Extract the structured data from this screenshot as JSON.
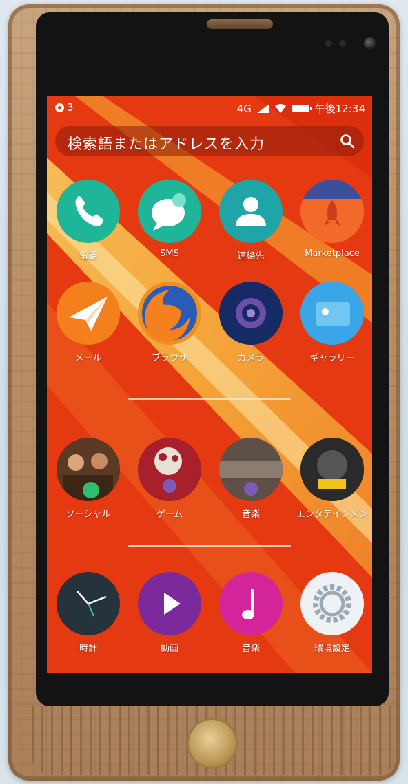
{
  "status_bar": {
    "notification_count": "3",
    "network": "4G",
    "time": "午後12:34"
  },
  "search": {
    "placeholder": "検索語またはアドレスを入力"
  },
  "apps_row1": [
    {
      "label": "電話",
      "icon": "phone-icon",
      "color": "#1fb598"
    },
    {
      "label": "SMS",
      "icon": "sms-icon",
      "color": "#1fb598"
    },
    {
      "label": "連絡先",
      "icon": "contacts-icon",
      "color": "#1fa4a8"
    },
    {
      "label": "Marketplace",
      "icon": "marketplace-icon",
      "color": "#f2692a"
    }
  ],
  "apps_row2": [
    {
      "label": "メール",
      "icon": "mail-icon",
      "color": "#f3801d"
    },
    {
      "label": "ブラウザ",
      "icon": "browser-icon",
      "color": "#f08f1f"
    },
    {
      "label": "カメラ",
      "icon": "camera-icon",
      "color": "#162a66"
    },
    {
      "label": "ギャラリー",
      "icon": "gallery-icon",
      "color": "#3aa6e8"
    }
  ],
  "apps_row3": [
    {
      "label": "ソーシャル",
      "icon": "social-icon",
      "color": "#5b3a25"
    },
    {
      "label": "ゲーム",
      "icon": "games-icon",
      "color": "#a8202c"
    },
    {
      "label": "音楽",
      "icon": "music-collection-icon",
      "color": "#5c5048"
    },
    {
      "label": "エンタテインメント",
      "icon": "entertainment-icon",
      "color": "#1a1a1a"
    }
  ],
  "apps_dock": [
    {
      "label": "時計",
      "icon": "clock-icon",
      "color": "#27333c"
    },
    {
      "label": "動画",
      "icon": "video-icon",
      "color": "#7b2a9b"
    },
    {
      "label": "音楽",
      "icon": "music-icon",
      "color": "#d4249a"
    },
    {
      "label": "環境設定",
      "icon": "settings-icon",
      "color": "#eef2f5"
    }
  ]
}
